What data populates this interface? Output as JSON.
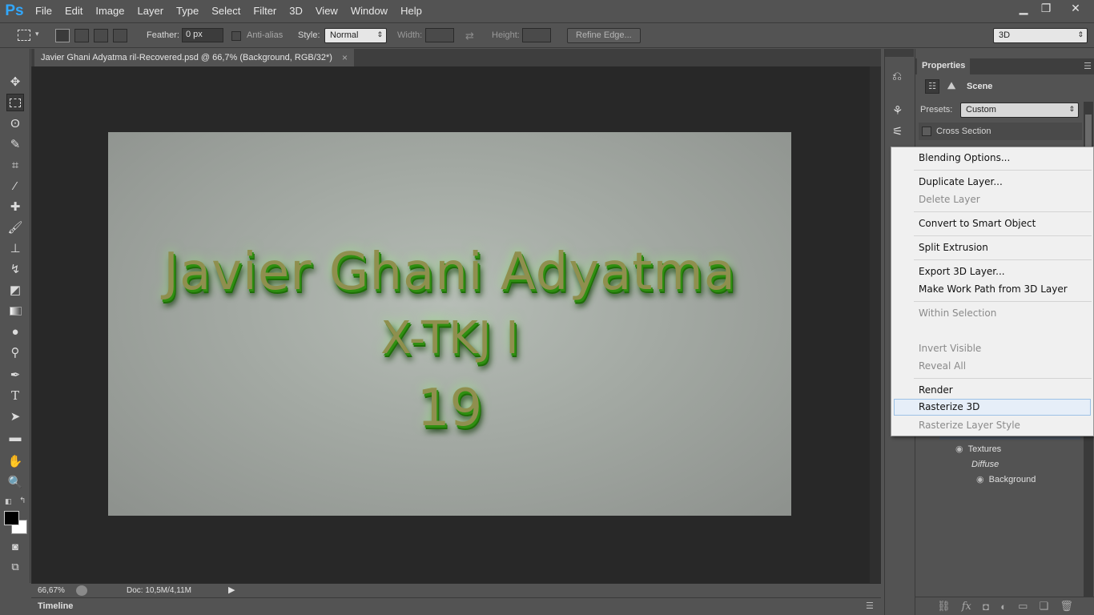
{
  "app": {
    "logo": "Ps",
    "menu": [
      "File",
      "Edit",
      "Image",
      "Layer",
      "Type",
      "Select",
      "Filter",
      "3D",
      "View",
      "Window",
      "Help"
    ]
  },
  "window_controls": {
    "minimize": "▁",
    "restore": "❐",
    "close": "✕"
  },
  "options": {
    "feather_label": "Feather:",
    "feather_value": "0 px",
    "antialias_label": "Anti-alias",
    "style_label": "Style:",
    "style_value": "Normal",
    "width_label": "Width:",
    "height_label": "Height:",
    "refine_edge": "Refine Edge...",
    "workspace": "3D"
  },
  "document": {
    "tab_title": "Javier Ghani Adyatma ril-Recovered.psd @ 66,7% (Background, RGB/32*)",
    "tab_close": "×",
    "canvas_lines": [
      "Javier Ghani Adyatma",
      "X-TKJ I",
      "19"
    ]
  },
  "status": {
    "zoom": "66,67%",
    "doc_info": "Doc: 10,5M/4,11M"
  },
  "timeline": {
    "label": "Timeline"
  },
  "properties": {
    "tab": "Properties",
    "scene_label": "Scene",
    "presets_label": "Presets:",
    "presets_value": "Custom",
    "cross_section": "Cross Section",
    "tree": {
      "textures": "Textures",
      "diffuse": "Diffuse",
      "background": "Background"
    }
  },
  "context_menu": {
    "items": [
      {
        "label": "Blending Options...",
        "enabled": true
      },
      {
        "label": "Duplicate Layer...",
        "enabled": true
      },
      {
        "label": "Delete Layer",
        "enabled": false
      },
      {
        "label": "Convert to Smart Object",
        "enabled": true
      },
      {
        "label": "Split Extrusion",
        "enabled": true
      },
      {
        "label": "Export 3D Layer...",
        "enabled": true
      },
      {
        "label": "Make Work Path from 3D Layer",
        "enabled": true
      },
      {
        "label": "Within Selection",
        "enabled": false
      },
      {
        "label": "Invert Visible",
        "enabled": false
      },
      {
        "label": "Reveal All",
        "enabled": false
      },
      {
        "label": "Render",
        "enabled": true
      },
      {
        "label": "Rasterize 3D",
        "enabled": true,
        "highlighted": true
      },
      {
        "label": "Rasterize Layer Style",
        "enabled": false
      }
    ]
  },
  "colors": {
    "ps_blue": "#31a8ff",
    "ui_bg": "#535353",
    "canvas_bg": "#282828",
    "menu_bg": "#f0f0f0",
    "hover": "#e6eef8"
  }
}
